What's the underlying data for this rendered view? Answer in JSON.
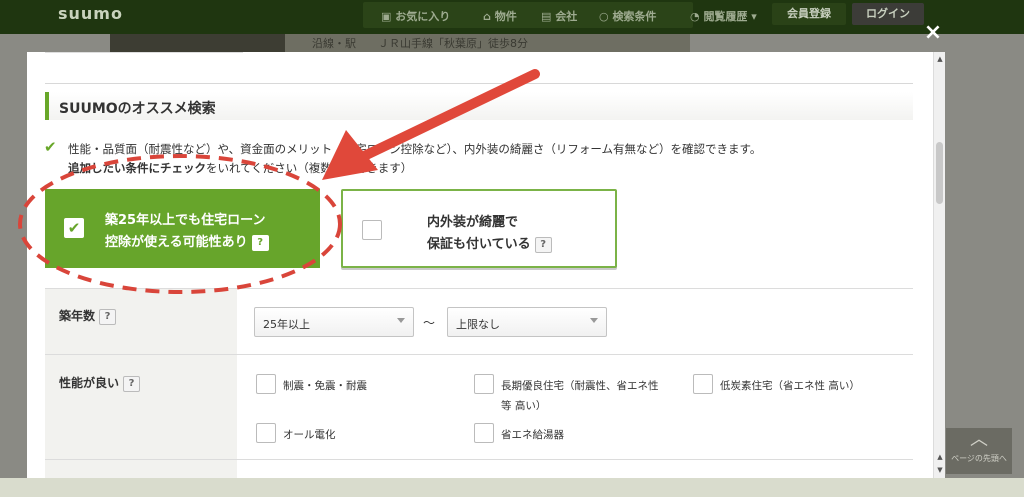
{
  "header": {
    "logo": "suumo",
    "nav": [
      {
        "icon": "heart-icon",
        "label": "お気に入り"
      },
      {
        "icon": "house-icon",
        "label": "物件"
      },
      {
        "icon": "building-icon",
        "label": "会社"
      },
      {
        "icon": "search-icon",
        "label": "検索条件"
      },
      {
        "icon": "clock-icon",
        "label": "閲覧履歴"
      }
    ],
    "register_label": "会員登録",
    "login_label": "ログイン"
  },
  "background": {
    "meta_label": "沿線・駅",
    "meta_value": "ＪＲ山手線「秋葉原」徒歩8分",
    "pagetop_label": "ページの先頭へ"
  },
  "modal": {
    "close_glyph": "×",
    "section_title": "SUUMOのオススメ検索",
    "desc_line1": "性能・品質面（耐震性など）や、資金面のメリット（住宅ローン控除など）、内外装の綺麗さ（リフォーム有無など）を確認できます。",
    "desc_line2_bold": "追加したい条件にチェック",
    "desc_line2_rest": "をいれてください（複数選択できます）",
    "options": [
      {
        "line1": "築25年以上でも住宅ローン",
        "line2": "控除が使える可能性あり",
        "checked": true
      },
      {
        "line1": "内外装が綺麗で",
        "line2": "保証も付いている",
        "checked": false
      }
    ],
    "help_glyph": "?",
    "age": {
      "label": "築年数",
      "from": "25年以上",
      "separator": "～",
      "to": "上限なし"
    },
    "performance": {
      "label": "性能が良い",
      "items": [
        {
          "label_lines": [
            "制震・免震・耐震"
          ]
        },
        {
          "label_lines": [
            "長期優良住宅（耐震性、省エネ性",
            "等 高い）"
          ]
        },
        {
          "label_lines": [
            "低炭素住宅（省エネ性 高い）"
          ]
        },
        {
          "label_lines": [
            "オール電化"
          ]
        },
        {
          "label_lines": [
            "省エネ給湯器"
          ]
        }
      ]
    }
  },
  "annotations": {
    "arrow_color": "#e0483a",
    "ellipse_color": "#d9453a",
    "accent_green": "#67a52b"
  }
}
